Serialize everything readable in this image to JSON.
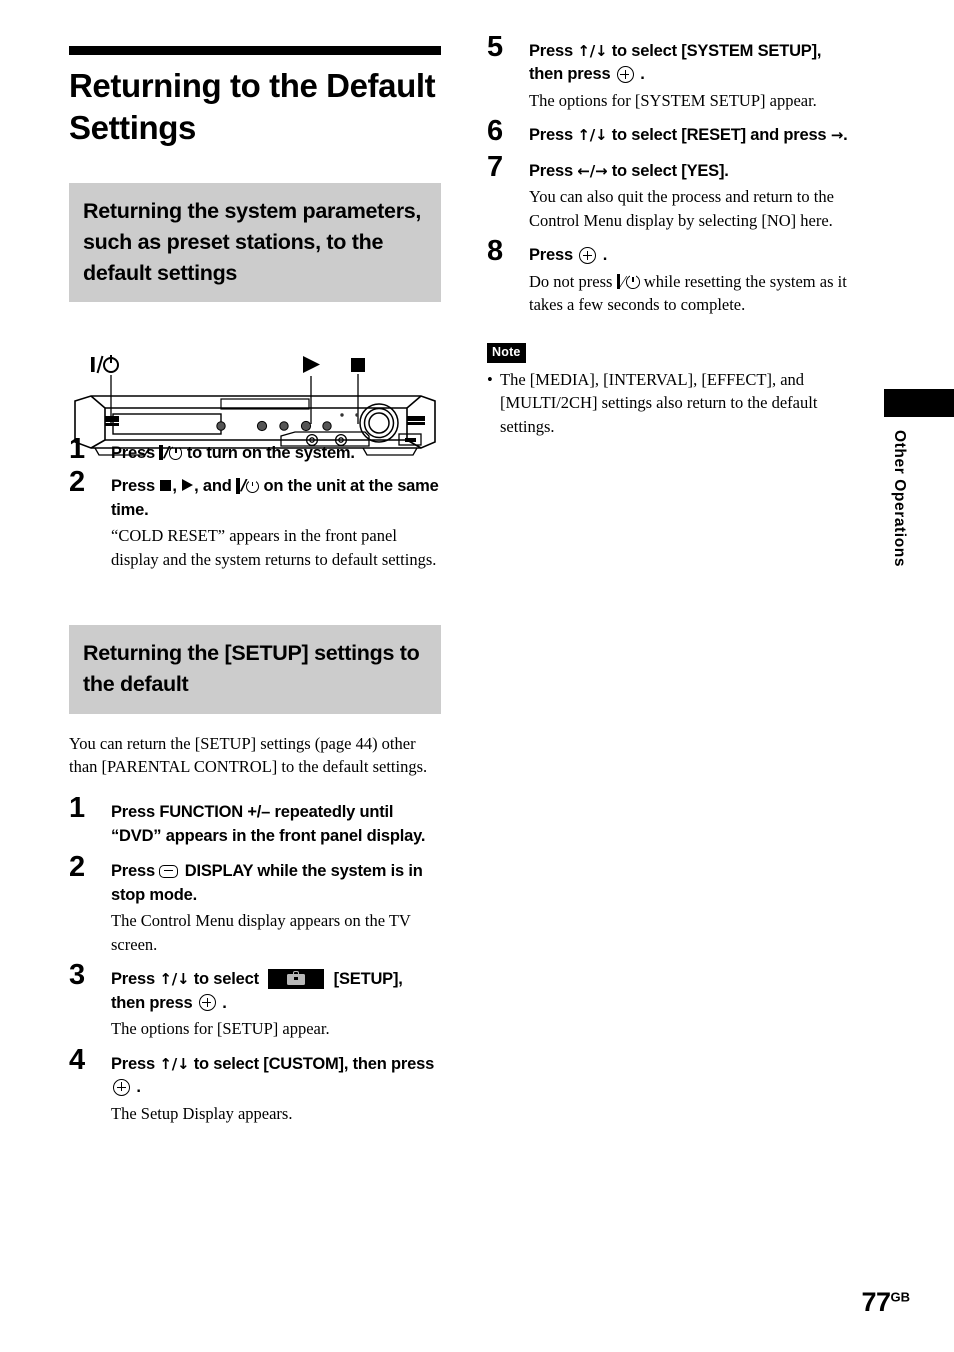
{
  "page": {
    "number": "77",
    "number_suffix": "GB",
    "side_tab_label": "Other Operations"
  },
  "chapter": {
    "title": "Returning to the Default Settings"
  },
  "section_1": {
    "heading": "Returning the system parameters, such as preset stations, to the default settings",
    "figure": {
      "name": "front-panel-diagram",
      "callouts": [
        "power-standby",
        "play",
        "stop"
      ]
    },
    "steps": [
      {
        "num": "1",
        "head_prefix": "Press ",
        "head_suffix": " to turn on the system.",
        "body": ""
      },
      {
        "num": "2",
        "head_part1": "Press ",
        "head_part2": ", ",
        "head_part3": ", and ",
        "head_part4": " on the unit at the same time.",
        "body": "“COLD RESET” appears in the front panel display and the system returns to default settings."
      }
    ]
  },
  "section_2": {
    "heading": "Returning the [SETUP] settings to the default",
    "intro": "You can return the [SETUP] settings (page 44) other than [PARENTAL CONTROL] to the default settings.",
    "steps": [
      {
        "num": "1",
        "head": "Press FUNCTION +/– repeatedly until “DVD” appears in the front panel display.",
        "body": ""
      },
      {
        "num": "2",
        "head_prefix": "Press ",
        "head_suffix": " DISPLAY while the system is in stop mode.",
        "body": "The Control Menu display appears on the TV screen."
      },
      {
        "num": "3",
        "head_p1": "Press ",
        "head_arrows": "↑/↓",
        "head_p2": " to select ",
        "head_p3": " [SETUP], then press ",
        "head_p4": " .",
        "body": "The options for [SETUP] appear."
      },
      {
        "num": "4",
        "head_p1": "Press ",
        "head_arrows": "↑/↓",
        "head_p2": " to select [CUSTOM], then press ",
        "head_p3": " .",
        "body": "The Setup Display appears."
      },
      {
        "num": "5",
        "head_p1": "Press ",
        "head_arrows": "↑/↓",
        "head_p2": " to select [SYSTEM SETUP], then press ",
        "head_p3": " .",
        "body": "The options for [SYSTEM SETUP] appear."
      },
      {
        "num": "6",
        "head_p1": "Press ",
        "head_arrows": "↑/↓",
        "head_p2": " to select [RESET] and press ",
        "head_arrow_right": "→",
        "head_p3": ".",
        "body": ""
      },
      {
        "num": "7",
        "head_p1": "Press ",
        "head_arrows": "←/→",
        "head_p2": " to select [YES].",
        "body": "You can also quit the process and return to the Control Menu display by selecting [NO] here."
      },
      {
        "num": "8",
        "head_p1": "Press ",
        "head_p2": " .",
        "body_prefix": "Do not press ",
        "body_suffix": " while resetting the system as it takes a few seconds to complete."
      }
    ]
  },
  "note": {
    "tag": "Note",
    "items": [
      "The [MEDIA], [INTERVAL], [EFFECT], and [MULTI/2CH] settings also return to the default settings."
    ]
  },
  "colors": {
    "gray_header_bg": "#cccccc",
    "rule": "#000000",
    "text": "#000000"
  }
}
